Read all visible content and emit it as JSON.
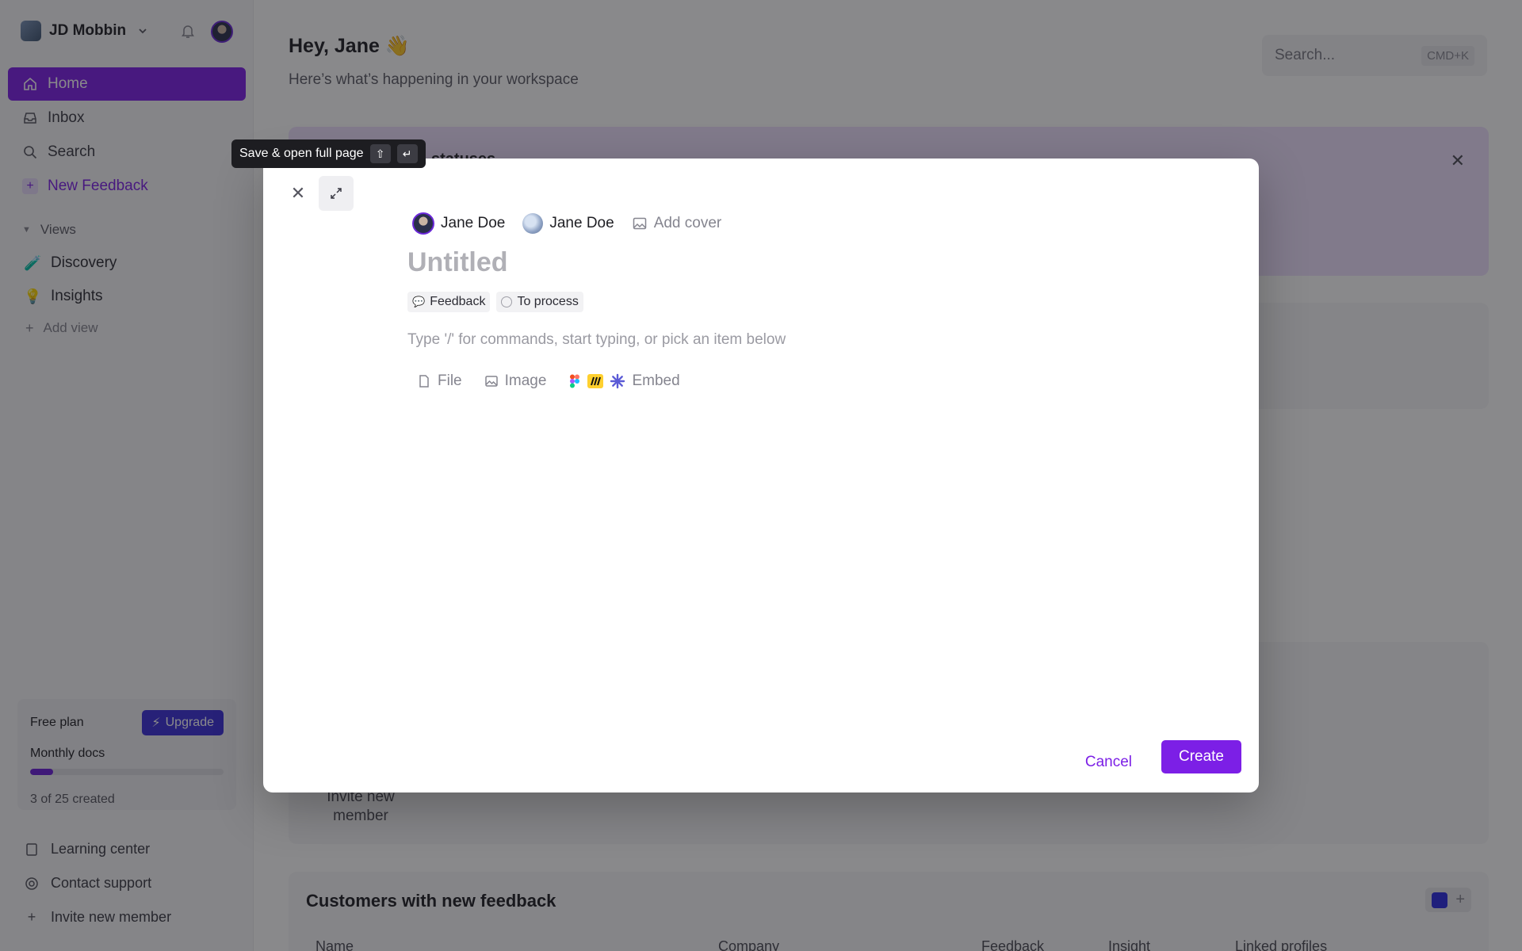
{
  "workspace": {
    "name": "JD Mobbin"
  },
  "sidebar": {
    "nav": [
      {
        "label": "Home"
      },
      {
        "label": "Inbox"
      },
      {
        "label": "Search"
      },
      {
        "label": "New Feedback"
      }
    ],
    "views_label": "Views",
    "views": [
      {
        "label": "Discovery",
        "emoji": "🧪"
      },
      {
        "label": "Insights",
        "emoji": "💡"
      }
    ],
    "add_view": "Add view",
    "plan": {
      "name": "Free plan",
      "upgrade": "Upgrade",
      "metric": "Monthly docs",
      "used": 3,
      "total": 25,
      "count_text": "3 of 25 created"
    },
    "bottom": [
      {
        "label": "Learning center"
      },
      {
        "label": "Contact support"
      },
      {
        "label": "Invite new member"
      }
    ]
  },
  "main": {
    "greeting": "Hey, Jane 👋",
    "subtitle": "Here’s what’s happening in your workspace",
    "search_placeholder": "Search...",
    "search_shortcut": "CMD+K",
    "banner_title_partial": "statuses",
    "invite_card_text": "Invite new member",
    "customers_title": "Customers with new feedback",
    "columns": [
      "Name",
      "Company",
      "Feedback",
      "Insight",
      "Linked profiles"
    ]
  },
  "tooltip": {
    "text": "Save & open full page",
    "key1": "⇧",
    "key2": "↵"
  },
  "modal": {
    "assignee1": "Jane Doe",
    "assignee2": "Jane Doe",
    "add_cover": "Add cover",
    "title_placeholder": "Untitled",
    "chip_type": "Feedback",
    "chip_status": "To process",
    "body_hint": "Type '/' for commands, start typing, or pick an item below",
    "attach_file": "File",
    "attach_image": "Image",
    "attach_embed": "Embed",
    "cancel": "Cancel",
    "create": "Create"
  },
  "colors": {
    "accent": "#7c1fe6",
    "upgrade": "#3a2ed8",
    "overlay": "rgba(20,20,24,0.5)"
  }
}
